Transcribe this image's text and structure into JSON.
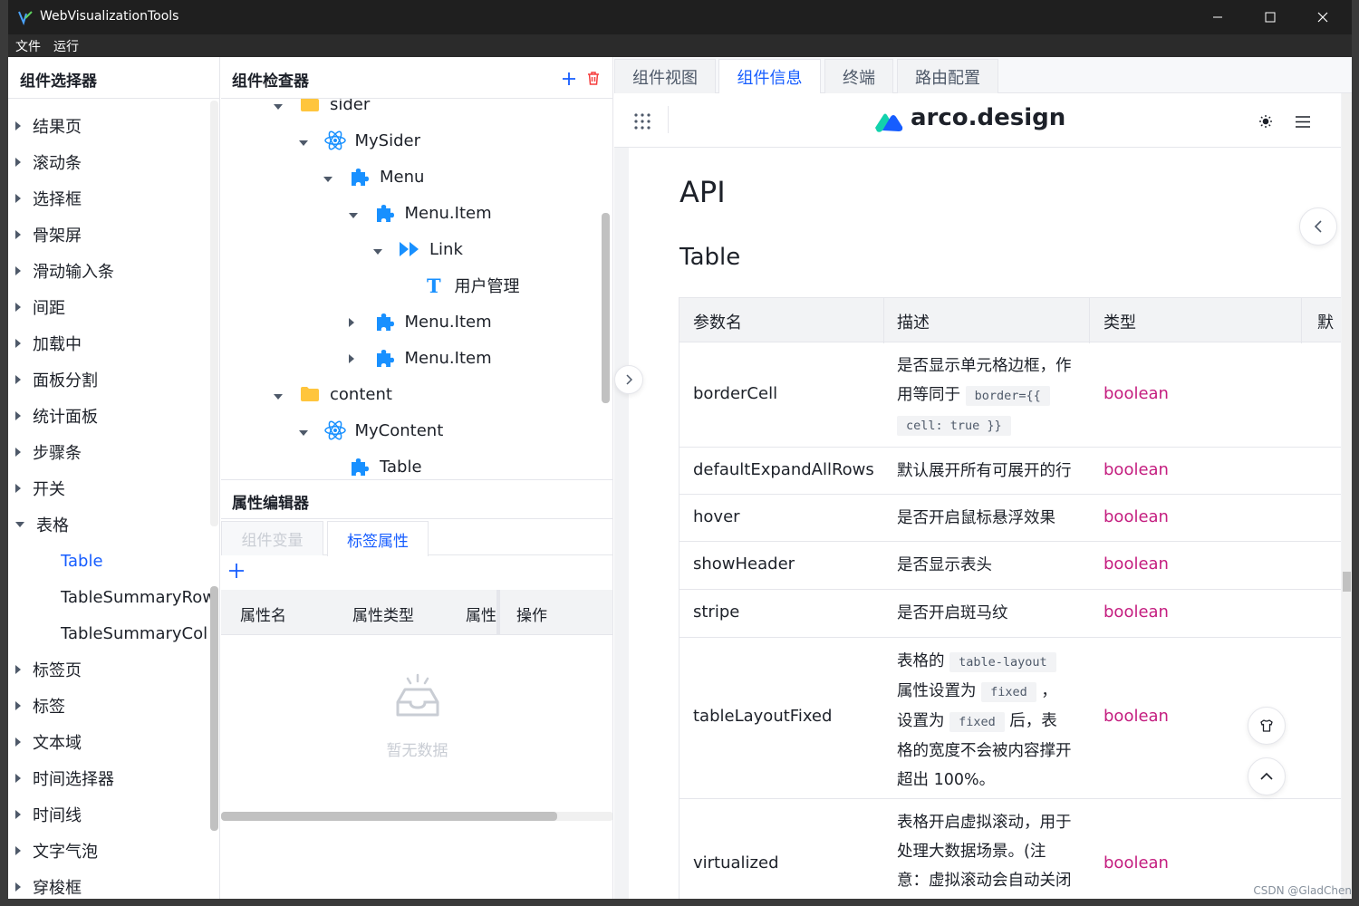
{
  "window": {
    "title": "WebVisualizationTools",
    "accent": "#165dff"
  },
  "menubar": {
    "file": "文件",
    "run": "运行"
  },
  "left": {
    "title": "组件选择器",
    "items": [
      {
        "label": "结果页",
        "caret": "right"
      },
      {
        "label": "滚动条",
        "caret": "right"
      },
      {
        "label": "选择框",
        "caret": "right"
      },
      {
        "label": "骨架屏",
        "caret": "right"
      },
      {
        "label": "滑动输入条",
        "caret": "right"
      },
      {
        "label": "间距",
        "caret": "right"
      },
      {
        "label": "加载中",
        "caret": "right"
      },
      {
        "label": "面板分割",
        "caret": "right"
      },
      {
        "label": "统计面板",
        "caret": "right"
      },
      {
        "label": "步骤条",
        "caret": "right"
      },
      {
        "label": "开关",
        "caret": "right"
      },
      {
        "label": "表格",
        "caret": "down"
      },
      {
        "label": "Table",
        "child": true,
        "active": true
      },
      {
        "label": "TableSummaryRow",
        "child": true
      },
      {
        "label": "TableSummaryCol",
        "child": true
      },
      {
        "label": "标签页",
        "caret": "right"
      },
      {
        "label": "标签",
        "caret": "right"
      },
      {
        "label": "文本域",
        "caret": "right"
      },
      {
        "label": "时间选择器",
        "caret": "right"
      },
      {
        "label": "时间线",
        "caret": "right"
      },
      {
        "label": "文字气泡",
        "caret": "right"
      },
      {
        "label": "穿梭框",
        "caret": "right"
      }
    ]
  },
  "inspector": {
    "title": "组件检查器",
    "add_icon": "plus-icon",
    "delete_icon": "trash-icon",
    "tree": [
      {
        "label": "sider",
        "icon": "folder-icon",
        "indent": 0,
        "caret": "down"
      },
      {
        "label": "MySider",
        "icon": "react-icon",
        "indent": 1,
        "caret": "down"
      },
      {
        "label": "Menu",
        "icon": "puzzle-icon",
        "indent": 2,
        "caret": "down"
      },
      {
        "label": "Menu.Item",
        "icon": "puzzle-icon",
        "indent": 3,
        "caret": "down"
      },
      {
        "label": "Link",
        "icon": "forward-icon",
        "indent": 4,
        "caret": "down"
      },
      {
        "label": "用户管理",
        "icon": "text-icon",
        "indent": 5,
        "caret": "none"
      },
      {
        "label": "Menu.Item",
        "icon": "puzzle-icon",
        "indent": 3,
        "caret": "right"
      },
      {
        "label": "Menu.Item",
        "icon": "puzzle-icon",
        "indent": 3,
        "caret": "right"
      },
      {
        "label": "content",
        "icon": "folder-icon",
        "indent": 0,
        "caret": "down"
      },
      {
        "label": "MyContent",
        "icon": "react-icon",
        "indent": 1,
        "caret": "down"
      },
      {
        "label": "Table",
        "icon": "puzzle-icon",
        "indent": 2,
        "caret": "none"
      }
    ]
  },
  "props": {
    "title": "属性编辑器",
    "tabs": [
      "组件变量",
      "标签属性"
    ],
    "active_tab": 1,
    "columns": [
      "属性名",
      "属性类型",
      "属性",
      "操作"
    ],
    "empty_text": "暂无数据"
  },
  "right": {
    "tabs": [
      "组件视图",
      "组件信息",
      "终端",
      "路由配置"
    ],
    "active_tab": 1,
    "brand": "arco.design",
    "h1": "API",
    "h2": "Table",
    "table_head": [
      "参数名",
      "描述",
      "类型",
      "默"
    ],
    "rows": [
      {
        "name": "borderCell",
        "type": "boolean"
      },
      {
        "name": "defaultExpandAllRows",
        "desc": "默认展开所有可展开的行",
        "type": "boolean"
      },
      {
        "name": "hover",
        "desc": "是否开启鼠标悬浮效果",
        "type": "boolean"
      },
      {
        "name": "showHeader",
        "desc": "是否显示表头",
        "type": "boolean"
      },
      {
        "name": "stripe",
        "desc": "是否开启斑马纹",
        "type": "boolean"
      },
      {
        "name": "tableLayoutFixed",
        "type": "boolean"
      },
      {
        "name": "virtualized",
        "type": "boolean"
      }
    ],
    "desc_border": {
      "a": "是否显示单元格边框，作",
      "b": "用等同于",
      "code1": "border={{",
      "code2": "cell: true }}"
    },
    "desc_layout": {
      "a": "表格的",
      "code1": "table-layout",
      "b": "属性设置为",
      "code2": "fixed",
      "c": "，",
      "d": "设置为",
      "code3": "fixed",
      "e": "后，表",
      "f": "格的宽度不会被内容撑开",
      "g": "超出 100%。"
    },
    "desc_virtual": {
      "a": "表格开启虚拟滚动，用于",
      "b": "处理大数据场景。(注",
      "c": "意：虚拟滚动会自动关闭"
    }
  },
  "watermark": "CSDN @GladChen"
}
